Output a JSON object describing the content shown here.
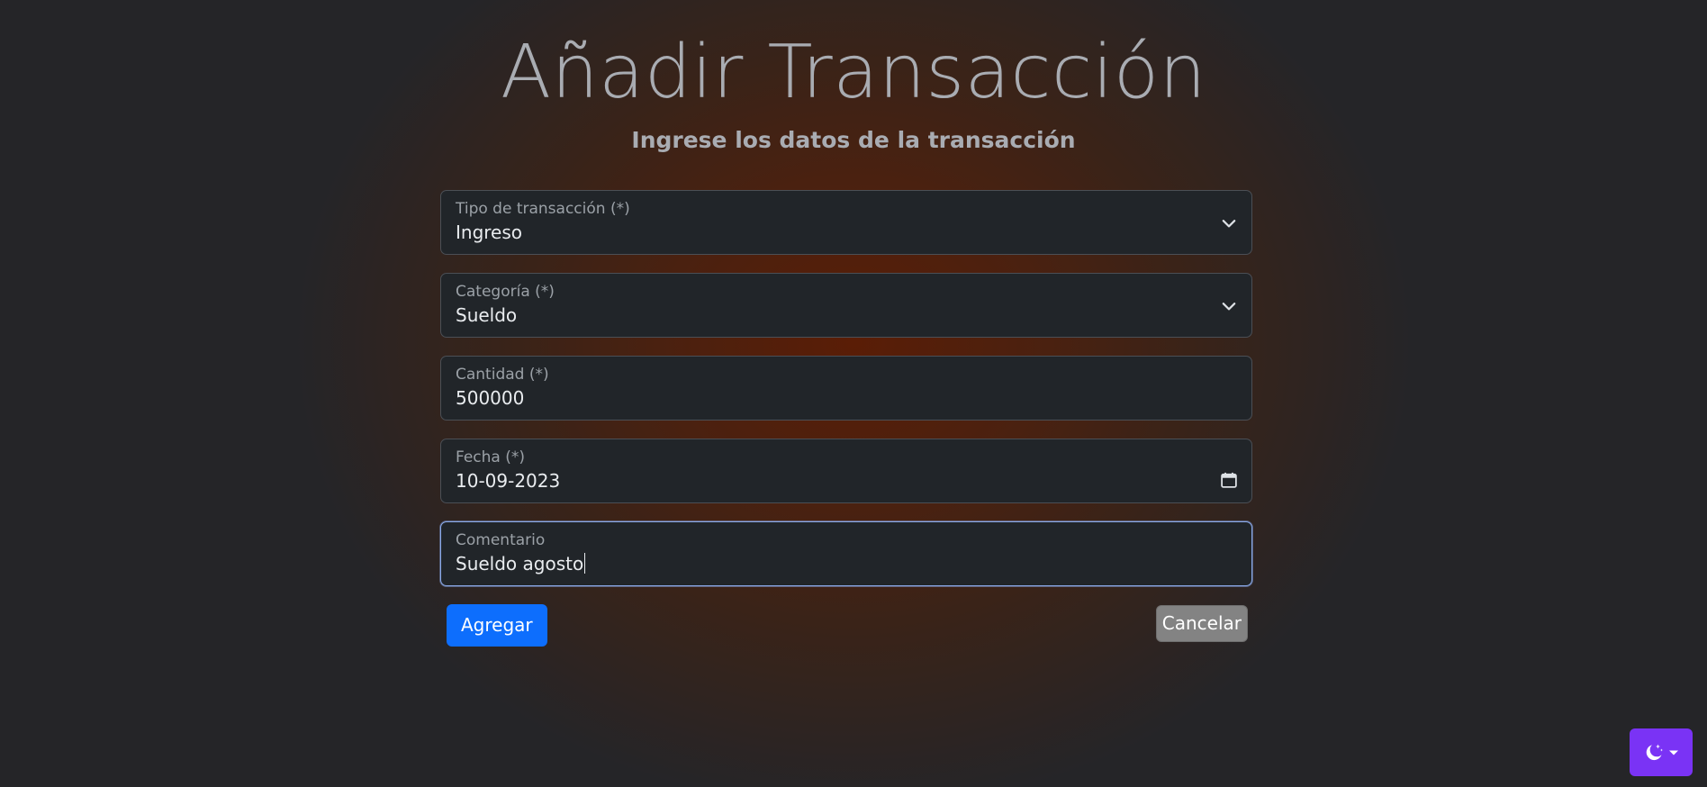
{
  "header": {
    "title": "Añadir Transacción",
    "subtitle": "Ingrese los datos de la transacción"
  },
  "form": {
    "tipo": {
      "label": "Tipo de transacción (*)",
      "value": "Ingreso",
      "icon": "chevron-down-icon"
    },
    "categoria": {
      "label": "Categoría (*)",
      "value": "Sueldo",
      "icon": "chevron-down-icon"
    },
    "cantidad": {
      "label": "Cantidad (*)",
      "value": "500000"
    },
    "fecha": {
      "label": "Fecha (*)",
      "value": "10-09-2023",
      "icon": "calendar-icon"
    },
    "comentario": {
      "label": "Comentario",
      "value": "Sueldo agosto",
      "focused": true
    }
  },
  "actions": {
    "submit_label": "Agregar",
    "cancel_label": "Cancelar"
  },
  "theme_toggle": {
    "icon": "moon-stars-icon",
    "dropdown_icon": "caret-down-icon",
    "color": "#7a33f5"
  },
  "colors": {
    "primary": "#0d6efd",
    "cancel": "#838383",
    "field_bg": "#212529",
    "focus_border": "#8aa9e8"
  }
}
